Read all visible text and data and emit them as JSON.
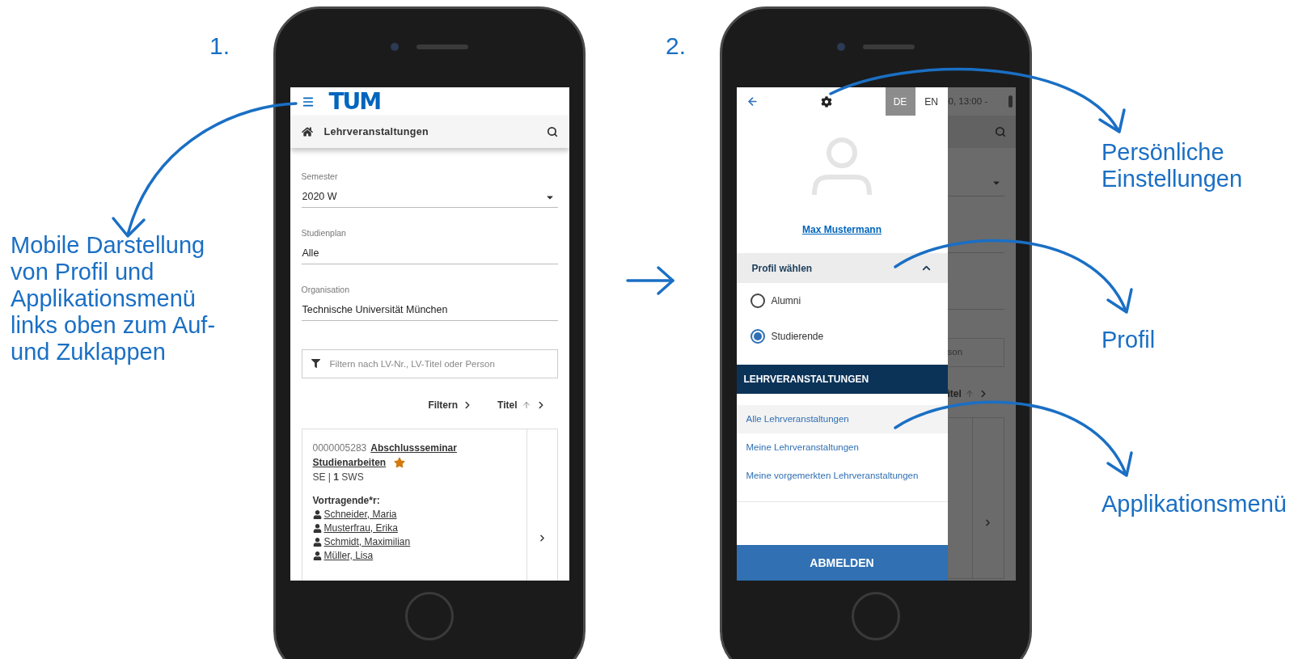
{
  "step_1": {
    "number": "1.",
    "caption_lines": [
      "Mobile Darstellung",
      "von Profil und",
      "Applikationsmenü",
      "links oben zum Auf-",
      "und Zuklappen"
    ]
  },
  "screen_1": {
    "logo": "TUM",
    "header": {
      "title": "Lehrveranstaltungen"
    },
    "fields": [
      {
        "label": "Semester",
        "value": "2020 W",
        "kind": "select"
      },
      {
        "label": "Studienplan",
        "value": "Alle",
        "kind": "text"
      },
      {
        "label": "Organisation",
        "value": "Technische Universität München",
        "kind": "text"
      }
    ],
    "filter": {
      "placeholder": "Filtern nach LV-Nr., LV-Titel oder Person"
    },
    "sort_bar": [
      {
        "label": "Filtern",
        "kind": "filter"
      },
      {
        "label": "Titel",
        "kind": "sort"
      }
    ],
    "course": {
      "number": "0000005283",
      "title": "Abschlussseminar Studienarbeiten",
      "favorite": true,
      "type_line": "SE | **1** SWS",
      "lecturers_label": "Vortragende*r:",
      "lecturers": [
        "Schneider, Maria",
        "Musterfrau, Erika",
        "Schmidt, Maximilian",
        "Müller, Lisa"
      ]
    }
  },
  "step_2": {
    "number": "2."
  },
  "screen_2": {
    "languages": [
      {
        "label": "DE",
        "selected": true
      },
      {
        "label": "EN",
        "selected": false
      }
    ],
    "user_name": "Max Mustermann",
    "profile_section": {
      "title": "Profil wählen",
      "expanded": true,
      "options": [
        {
          "label": "Alumni",
          "selected": false
        },
        {
          "label": "Studierende",
          "selected": true
        }
      ]
    },
    "menu": {
      "title": "LEHRVERANSTALTUNGEN",
      "items": [
        {
          "label": "Alle Lehrveranstaltungen",
          "selected": true
        },
        {
          "label": "Meine Lehrveranstaltungen",
          "selected": false
        },
        {
          "label": "Meine vorgemerkten Lehrveranstaltungen",
          "selected": false
        }
      ]
    },
    "logout": "ABMELDEN",
    "background_page": {
      "time_fragment": "0, 13:00 -",
      "filter_fragment": "son",
      "sort_fragment": "itel"
    }
  },
  "annotations": [
    {
      "lines": [
        "Persönliche",
        "Einstellungen"
      ]
    },
    {
      "lines": [
        "Profil"
      ]
    },
    {
      "lines": [
        "Applikationsmenü"
      ]
    }
  ]
}
